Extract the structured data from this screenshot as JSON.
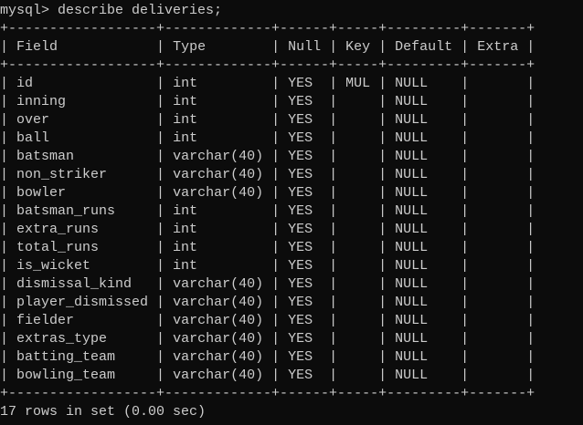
{
  "terminal": {
    "prompt": "mysql>",
    "command": "describe deliveries;",
    "status": "17 rows in set (0.00 sec)",
    "colors": {
      "background": "#0c0c0c",
      "foreground": "#cccccc"
    }
  },
  "table": {
    "columns": [
      "Field",
      "Type",
      "Null",
      "Key",
      "Default",
      "Extra"
    ],
    "rows": [
      [
        "id",
        "int",
        "YES",
        "MUL",
        "NULL",
        ""
      ],
      [
        "inning",
        "int",
        "YES",
        "",
        "NULL",
        ""
      ],
      [
        "over",
        "int",
        "YES",
        "",
        "NULL",
        ""
      ],
      [
        "ball",
        "int",
        "YES",
        "",
        "NULL",
        ""
      ],
      [
        "batsman",
        "varchar(40)",
        "YES",
        "",
        "NULL",
        ""
      ],
      [
        "non_striker",
        "varchar(40)",
        "YES",
        "",
        "NULL",
        ""
      ],
      [
        "bowler",
        "varchar(40)",
        "YES",
        "",
        "NULL",
        ""
      ],
      [
        "batsman_runs",
        "int",
        "YES",
        "",
        "NULL",
        ""
      ],
      [
        "extra_runs",
        "int",
        "YES",
        "",
        "NULL",
        ""
      ],
      [
        "total_runs",
        "int",
        "YES",
        "",
        "NULL",
        ""
      ],
      [
        "is_wicket",
        "int",
        "YES",
        "",
        "NULL",
        ""
      ],
      [
        "dismissal_kind",
        "varchar(40)",
        "YES",
        "",
        "NULL",
        ""
      ],
      [
        "player_dismissed",
        "varchar(40)",
        "YES",
        "",
        "NULL",
        ""
      ],
      [
        "fielder",
        "varchar(40)",
        "YES",
        "",
        "NULL",
        ""
      ],
      [
        "extras_type",
        "varchar(40)",
        "YES",
        "",
        "NULL",
        ""
      ],
      [
        "batting_team",
        "varchar(40)",
        "YES",
        "",
        "NULL",
        ""
      ],
      [
        "bowling_team",
        "varchar(40)",
        "YES",
        "",
        "NULL",
        ""
      ]
    ]
  }
}
